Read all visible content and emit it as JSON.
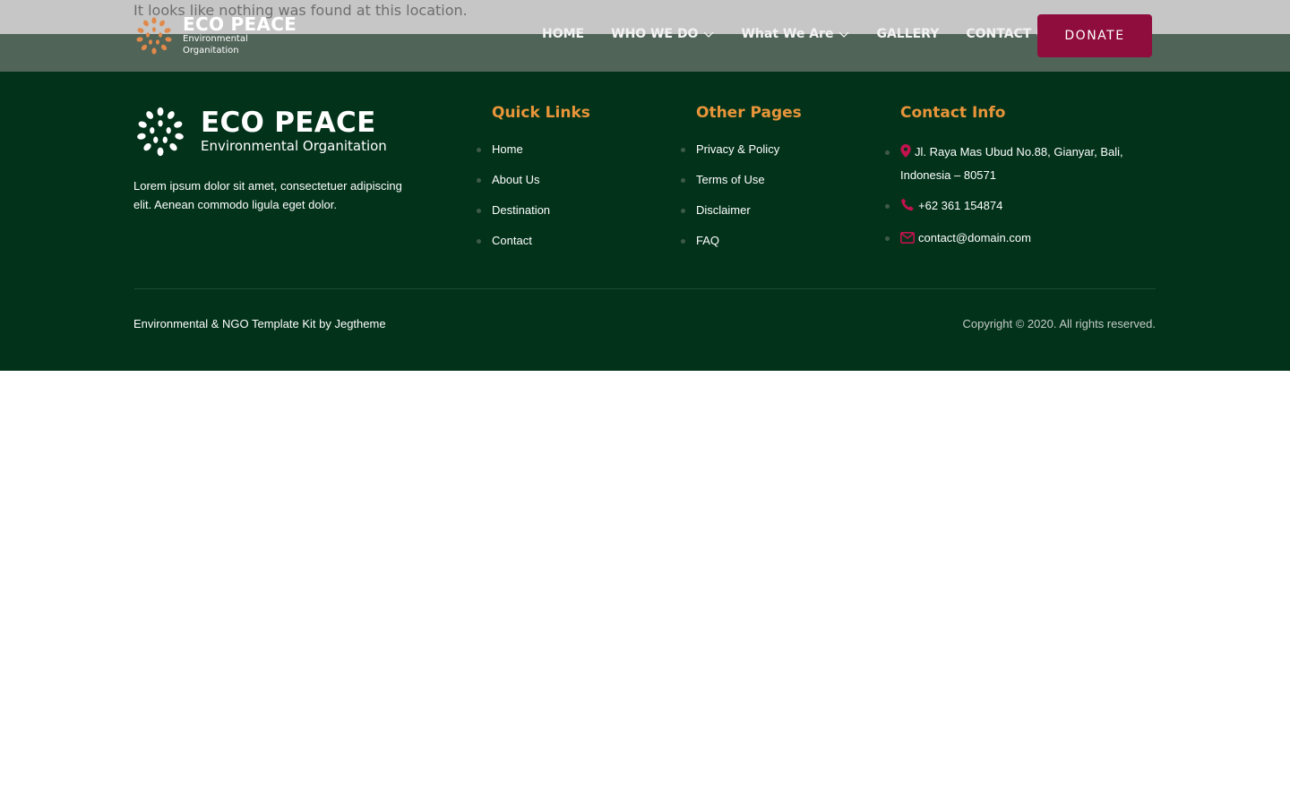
{
  "notfound": {
    "message": "It looks like nothing was found at this location."
  },
  "header": {
    "logo": {
      "name": "ECO PEACE",
      "tagline": "Environmental Organitation"
    },
    "nav": [
      {
        "label": "HOME"
      },
      {
        "label": "WHO WE DO",
        "icon": "chevron-down-icon"
      },
      {
        "label": "What We Are",
        "icon": "chevron-down-icon"
      },
      {
        "label": "GALLERY"
      },
      {
        "label": "CONTACT US"
      }
    ],
    "donate_label": "DONATE"
  },
  "footer": {
    "logo": {
      "name": "ECO PEACE",
      "tagline": "Environmental Organitation"
    },
    "description": "Lorem ipsum dolor sit amet, consectetuer adipiscing elit. Aenean commodo ligula eget dolor.",
    "quick_links": {
      "title": "Quick Links",
      "items": [
        "Home",
        "About Us",
        "Destination",
        "Contact"
      ]
    },
    "other_pages": {
      "title": "Other Pages",
      "items": [
        "Privacy & Policy",
        "Terms of Use",
        "Disclaimer",
        "FAQ"
      ]
    },
    "contact_info": {
      "title": "Contact Info",
      "address": "Jl. Raya Mas Ubud No.88, Gianyar, Bali, Indonesia – 80571",
      "phone": "+62 361 154874",
      "email": "contact@domain.com"
    },
    "credit": "Environmental & NGO Template Kit by Jegtheme",
    "copyright": "Copyright © 2020. All rights reserved."
  },
  "colors": {
    "footer_bg": "#02321a",
    "accent_orange": "#e8953a",
    "donate_bg": "#8f0d3c",
    "icon_red": "#c2134e"
  }
}
